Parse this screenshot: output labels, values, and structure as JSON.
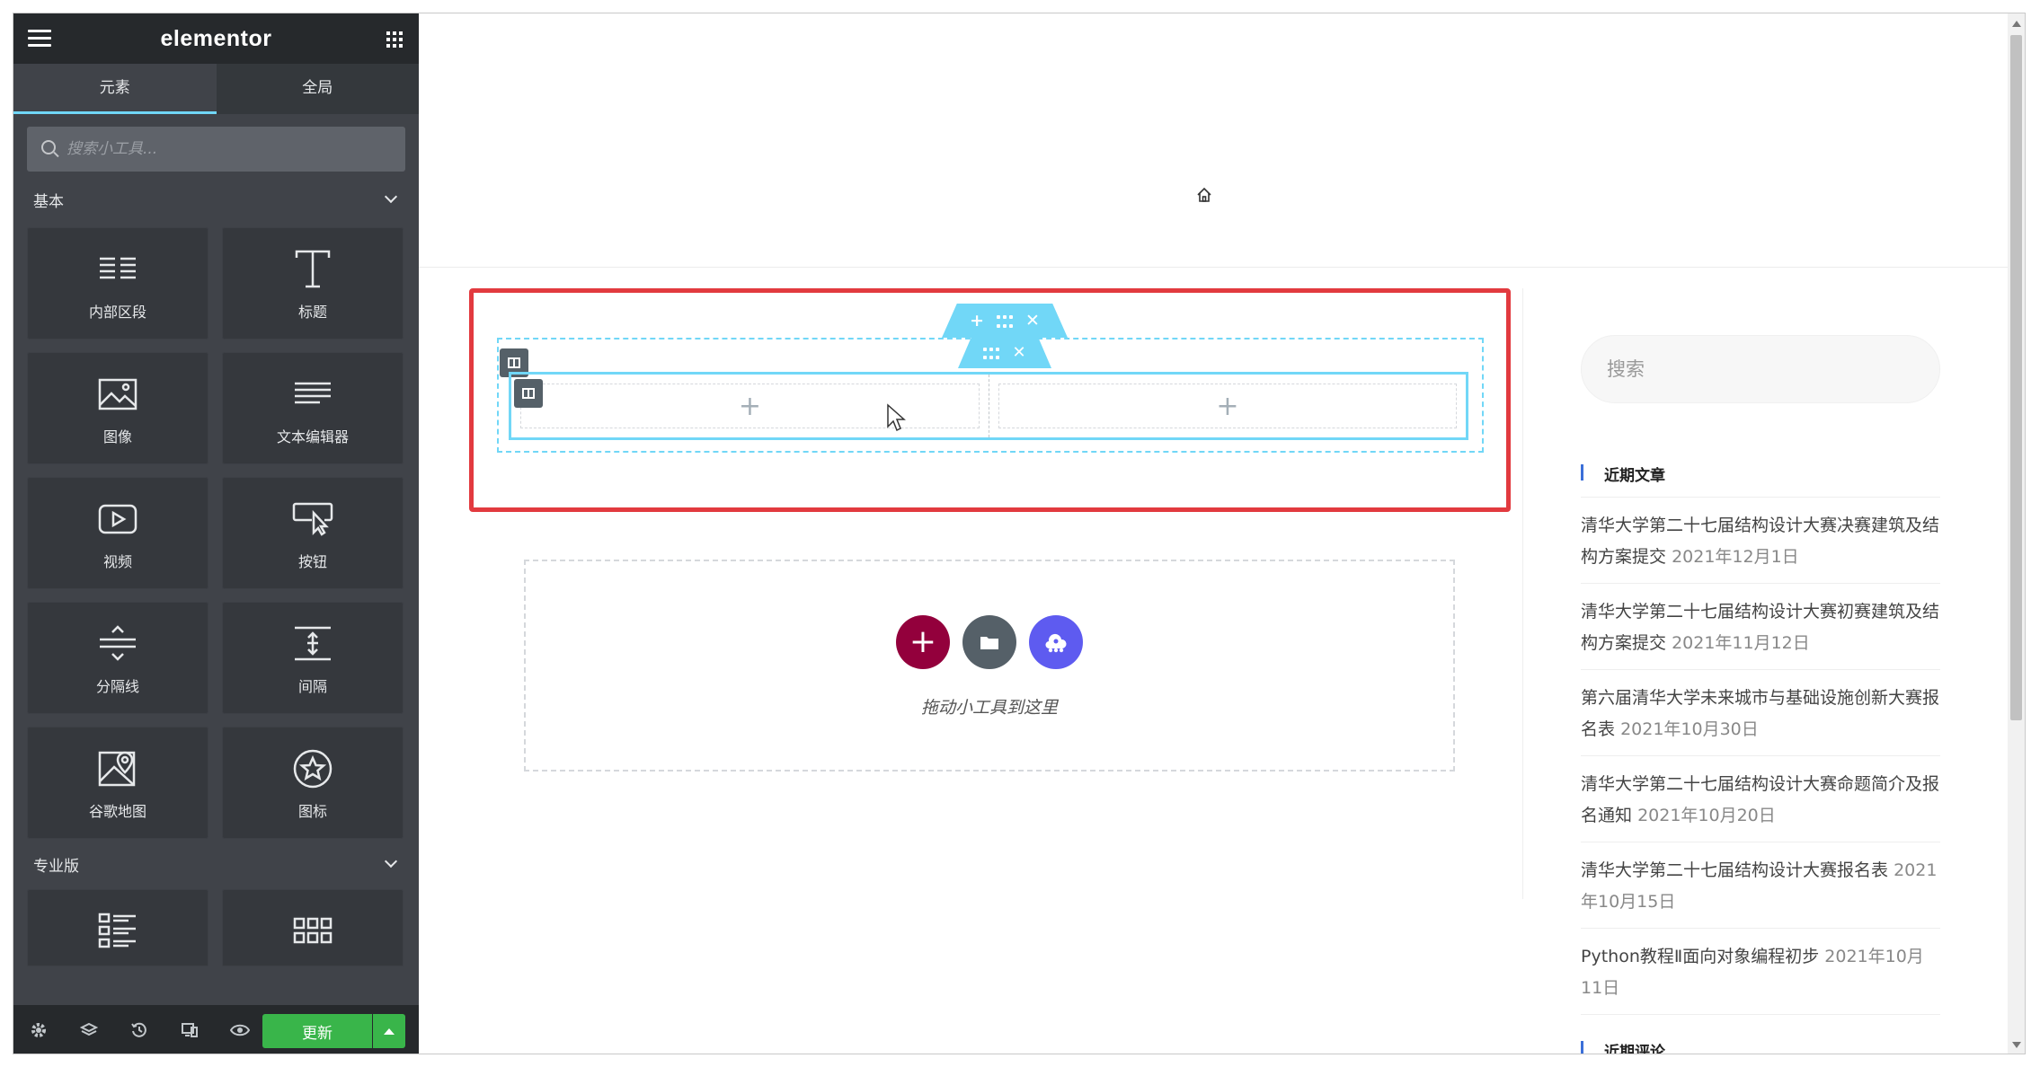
{
  "panel": {
    "logo": "elementor",
    "tabs": [
      "元素",
      "全局"
    ],
    "search_placeholder": "搜索小工具...",
    "category_basic": "基本",
    "category_pro": "专业版",
    "widgets": [
      {
        "label": "内部区段",
        "icon": "inner-section-icon"
      },
      {
        "label": "标题",
        "icon": "heading-icon"
      },
      {
        "label": "图像",
        "icon": "image-icon"
      },
      {
        "label": "文本编辑器",
        "icon": "text-editor-icon"
      },
      {
        "label": "视频",
        "icon": "video-icon"
      },
      {
        "label": "按钮",
        "icon": "button-icon"
      },
      {
        "label": "分隔线",
        "icon": "divider-icon"
      },
      {
        "label": "间隔",
        "icon": "spacer-icon"
      },
      {
        "label": "谷歌地图",
        "icon": "google-maps-icon"
      },
      {
        "label": "图标",
        "icon": "star-icon"
      }
    ],
    "pro_widgets": [
      {
        "icon": "posts-list-icon"
      },
      {
        "icon": "portfolio-grid-icon"
      }
    ],
    "footer": {
      "update_label": "更新"
    }
  },
  "canvas": {
    "drop_text": "拖动小工具到这里",
    "column_plus": "+",
    "sidebar": {
      "search_placeholder": "搜索",
      "recent_posts_title": "近期文章",
      "recent_comments_title": "近期评论",
      "posts": [
        {
          "title": "清华大学第二十七届结构设计大赛决赛建筑及结构方案提交",
          "date": "2021年12月1日"
        },
        {
          "title": "清华大学第二十七届结构设计大赛初赛建筑及结构方案提交",
          "date": "2021年11月12日"
        },
        {
          "title": "第六届清华大学未来城市与基础设施创新大赛报名表",
          "date": "2021年10月30日"
        },
        {
          "title": "清华大学第二十七届结构设计大赛命题简介及报名通知",
          "date": "2021年10月20日"
        },
        {
          "title": "清华大学第二十七届结构设计大赛报名表",
          "date": "2021年10月15日"
        },
        {
          "title": "Python教程Ⅱ面向对象编程初步",
          "date": "2021年10月11日"
        }
      ]
    }
  },
  "colors": {
    "panel_bg": "#404349",
    "accent_cyan": "#71d7f7",
    "highlight_red": "#e23a3f",
    "update_green": "#39b54a",
    "add_button": "#93003c",
    "ai_button": "#5e5bf0"
  }
}
